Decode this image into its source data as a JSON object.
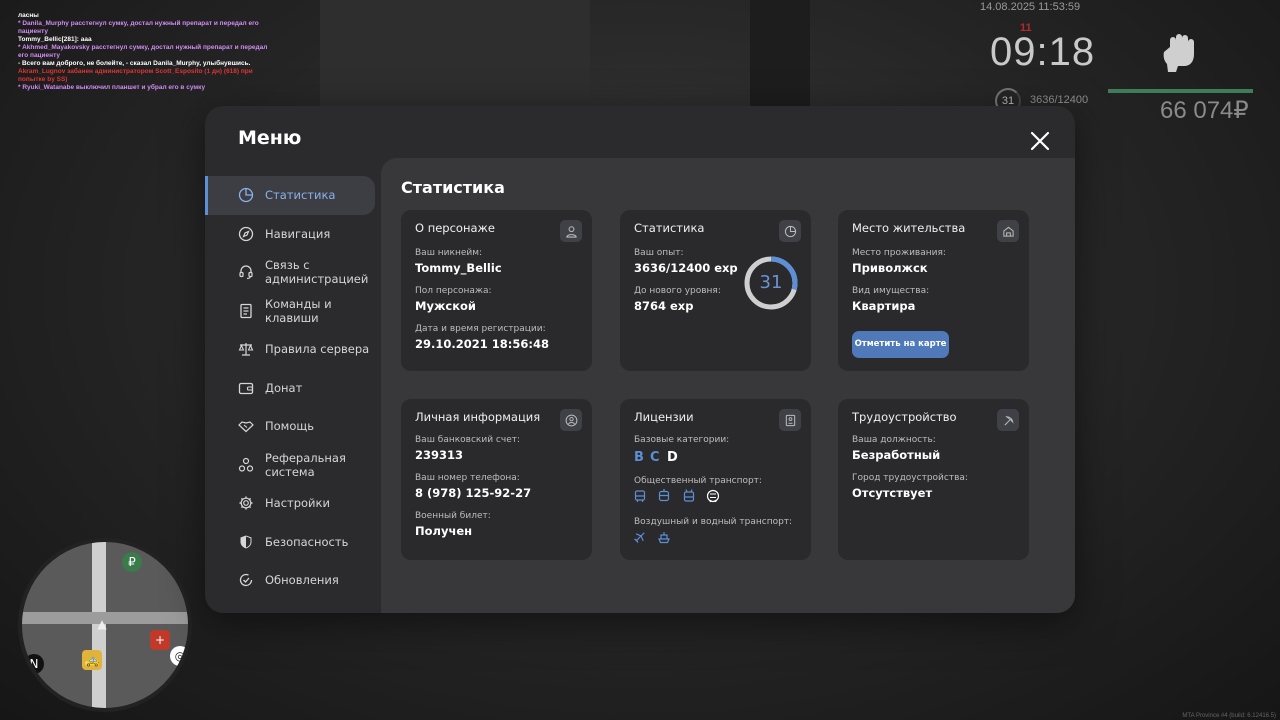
{
  "chat": [
    {
      "text": "ласны",
      "color": "#ffffff"
    },
    {
      "text": "* Danila_Murphy расстегнул сумку, достал нужный препарат и передал его пациенту",
      "color": "#d08df2"
    },
    {
      "text": "Tommy_Bellic[281]: ааа",
      "color": "#ffffff"
    },
    {
      "text": "* Akhmed_Mayakovsky расстегнул сумку, достал нужный препарат и передал его пациенту",
      "color": "#d08df2"
    },
    {
      "text": "- Всего вам доброго, не болейте, - сказал Danila_Murphy, улыбнувшись.",
      "color": "#ffffff"
    },
    {
      "text": "Akram_Lugnov забанен администратором Scott_Esposito (1 дн) (618) при попытке by SS)",
      "color": "#e03434"
    },
    {
      "text": "* Ryuki_Watanabe выключил планшет и убрал его в сумку",
      "color": "#d08df2"
    }
  ],
  "hud": {
    "datetime": "14.08.2025 11:53:59",
    "red_indicator": "11",
    "time": "09:18",
    "level": "31",
    "exp": "3636/12400",
    "money": "66 074₽",
    "build": "MTA Province #4 (build: 6.12416.5)"
  },
  "menu": {
    "title": "Меню",
    "sidebar": [
      {
        "label": "Статистика",
        "icon": "pie-chart-icon",
        "active": true
      },
      {
        "label": "Навигация",
        "icon": "compass-icon"
      },
      {
        "label": "Связь с администрацией",
        "icon": "headset-icon"
      },
      {
        "label": "Команды и клавиши",
        "icon": "document-icon"
      },
      {
        "label": "Правила сервера",
        "icon": "scales-icon"
      },
      {
        "label": "Донат",
        "icon": "wallet-icon"
      },
      {
        "label": "Помощь",
        "icon": "handshake-icon"
      },
      {
        "label": "Реферальная система",
        "icon": "referral-icon"
      },
      {
        "label": "Настройки",
        "icon": "gear-icon"
      },
      {
        "label": "Безопасность",
        "icon": "shield-icon"
      },
      {
        "label": "Обновления",
        "icon": "refresh-icon"
      }
    ]
  },
  "content": {
    "title": "Статистика",
    "character": {
      "title": "О персонаже",
      "nickname_label": "Ваш никнейм:",
      "nickname": "Tommy_Bellic",
      "gender_label": "Пол персонажа:",
      "gender": "Мужской",
      "reg_label": "Дата и время регистрации:",
      "reg_date": "29.10.2021 18:56:48"
    },
    "stats": {
      "title": "Статистика",
      "exp_label": "Ваш опыт:",
      "exp": "3636/12400 exp",
      "next_label": "До нового уровня:",
      "next": "8764 exp",
      "level": "31",
      "progress": 0.293
    },
    "residence": {
      "title": "Место жительства",
      "place_label": "Место проживания:",
      "place": "Приволжск",
      "property_label": "Вид имущества:",
      "property": "Квартира",
      "button": "Отметить на карте"
    },
    "personal": {
      "title": "Личная информация",
      "bank_label": "Ваш банковский счет:",
      "bank": "239313",
      "phone_label": "Ваш номер телефона:",
      "phone": "8 (978) 125-92-27",
      "military_label": "Военный билет:",
      "military": "Получен"
    },
    "licenses": {
      "title": "Лицензии",
      "base_label": "Базовые категории:",
      "categories": [
        {
          "letter": "B",
          "color": "#5c8fd6"
        },
        {
          "letter": "C",
          "color": "#5c8fd6"
        },
        {
          "letter": "D",
          "color": "#ffffff"
        }
      ],
      "public_label": "Общественный транспорт:",
      "air_label": "Воздушный и водный транспорт:",
      "accent": "#5c8fd6"
    },
    "employment": {
      "title": "Трудоустройство",
      "position_label": "Ваша должность:",
      "position": "Безработный",
      "city_label": "Город трудоустройства:",
      "city": "Отсутствует"
    }
  }
}
